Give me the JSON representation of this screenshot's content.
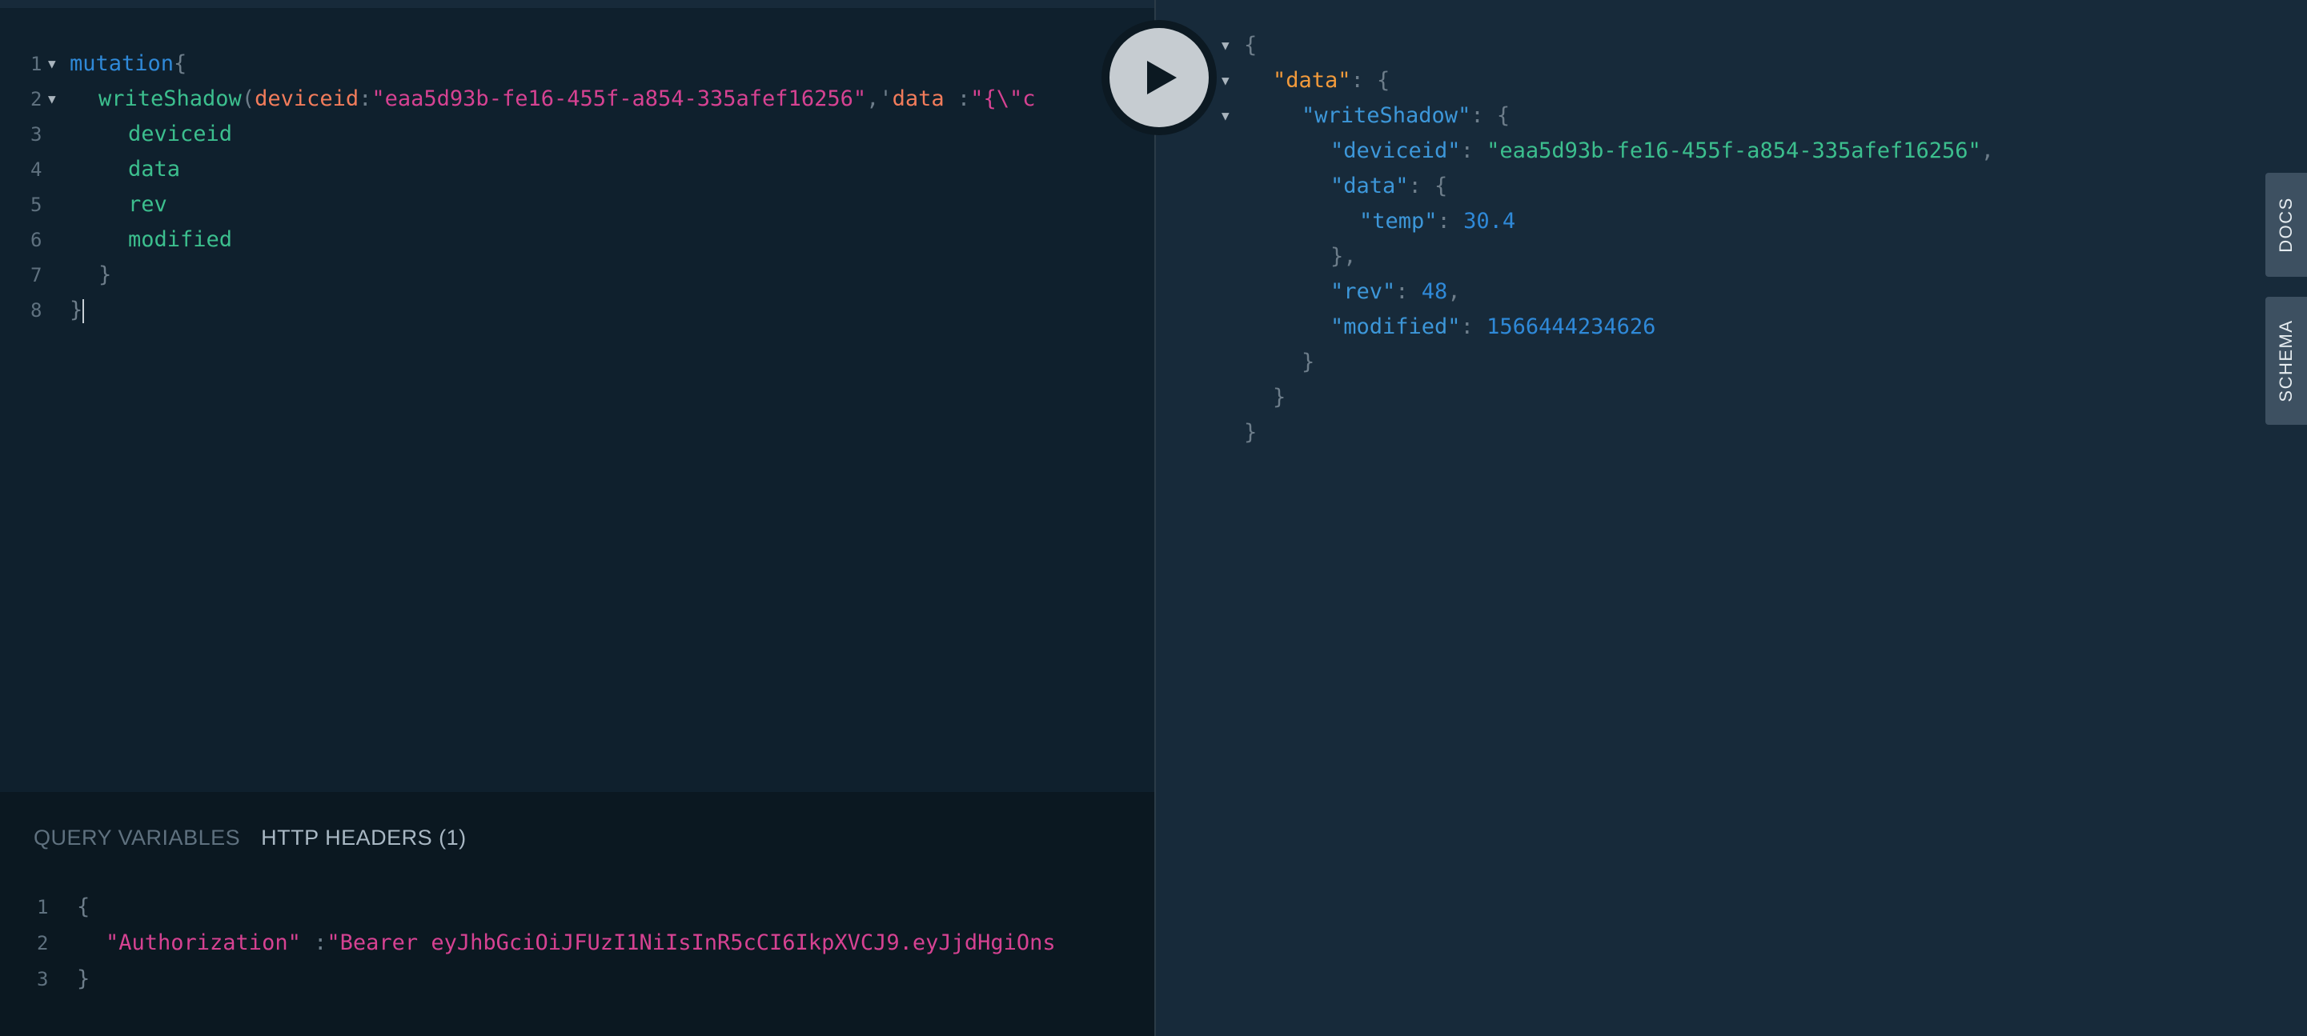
{
  "query_editor": {
    "lines": [
      {
        "n": "1",
        "parts": [
          [
            "kw",
            "mutation"
          ],
          [
            "punc",
            "{"
          ]
        ]
      },
      {
        "n": "2",
        "parts": [
          [
            "fn",
            "writeShadow"
          ],
          [
            "punc",
            "("
          ],
          [
            "arg",
            "deviceid"
          ],
          [
            "punc",
            ":"
          ],
          [
            "str",
            "\"eaa5d93b-fe16-455f-a854-335afef16256\""
          ],
          [
            "punc",
            ","
          ],
          [
            "punc",
            "'"
          ],
          [
            "arg",
            "data"
          ],
          [
            "punc",
            " :"
          ],
          [
            "str",
            "\"{\\\"c"
          ]
        ]
      },
      {
        "n": "3",
        "parts": [
          [
            "fn",
            "deviceid"
          ]
        ]
      },
      {
        "n": "4",
        "parts": [
          [
            "fn",
            "data"
          ]
        ]
      },
      {
        "n": "5",
        "parts": [
          [
            "fn",
            "rev"
          ]
        ]
      },
      {
        "n": "6",
        "parts": [
          [
            "fn",
            "modified"
          ]
        ]
      },
      {
        "n": "7",
        "parts": [
          [
            "punc",
            "}"
          ]
        ]
      },
      {
        "n": "8",
        "parts": [
          [
            "punc",
            "}"
          ]
        ]
      }
    ]
  },
  "variables_panel": {
    "tabs": [
      "QUERY VARIABLES",
      "HTTP HEADERS (1)"
    ],
    "active_tab": "HTTP HEADERS (1)",
    "lines": [
      {
        "n": "1",
        "parts": [
          [
            "punc",
            "{"
          ]
        ]
      },
      {
        "n": "2",
        "parts": [
          [
            "str",
            "\"Authorization\""
          ],
          [
            "punc",
            " :"
          ],
          [
            "str",
            "\"Bearer eyJhbGciOiJFUzI1NiIsInR5cCI6IkpXVCJ9.eyJjdHgiOns"
          ]
        ]
      },
      {
        "n": "3",
        "parts": [
          [
            "punc",
            "}"
          ]
        ]
      }
    ]
  },
  "execute_button": {
    "icon": "play-icon"
  },
  "result": {
    "lines": [
      {
        "fold": true,
        "parts": [
          [
            "punc",
            "{"
          ]
        ]
      },
      {
        "fold": true,
        "parts": [
          [
            "key-top",
            "\"data\""
          ],
          [
            "punc",
            ": {"
          ]
        ]
      },
      {
        "fold": true,
        "parts": [
          [
            "key",
            "\"writeShadow\""
          ],
          [
            "punc",
            ": {"
          ]
        ]
      },
      {
        "fold": false,
        "parts": [
          [
            "key",
            "\"deviceid\""
          ],
          [
            "punc",
            ": "
          ],
          [
            "sval",
            "\"eaa5d93b-fe16-455f-a854-335afef16256\""
          ],
          [
            "punc",
            ","
          ]
        ]
      },
      {
        "fold": false,
        "parts": [
          [
            "key",
            "\"data\""
          ],
          [
            "punc",
            ": {"
          ]
        ]
      },
      {
        "fold": false,
        "parts": [
          [
            "key",
            "\"temp\""
          ],
          [
            "punc",
            ": "
          ],
          [
            "nval",
            "30.4"
          ]
        ]
      },
      {
        "fold": false,
        "parts": [
          [
            "punc",
            "},"
          ]
        ]
      },
      {
        "fold": false,
        "parts": [
          [
            "key",
            "\"rev\""
          ],
          [
            "punc",
            ": "
          ],
          [
            "nval",
            "48"
          ],
          [
            "punc",
            ","
          ]
        ]
      },
      {
        "fold": false,
        "parts": [
          [
            "key",
            "\"modified\""
          ],
          [
            "punc",
            ": "
          ],
          [
            "nval",
            "1566444234626"
          ]
        ]
      },
      {
        "fold": false,
        "parts": [
          [
            "punc",
            "}"
          ]
        ]
      },
      {
        "fold": false,
        "parts": [
          [
            "punc",
            "}"
          ]
        ]
      },
      {
        "fold": false,
        "parts": [
          [
            "punc",
            "}"
          ]
        ]
      }
    ]
  },
  "side_tabs": {
    "docs": "DOCS",
    "schema": "SCHEMA"
  },
  "colors": {
    "editor_bg": "#0f202d",
    "result_bg": "#172a3a",
    "keyword": "#2f89d8",
    "field": "#3cbf8e",
    "argument": "#f27c5b",
    "string": "#d64292",
    "top_key": "#f29a3b"
  }
}
